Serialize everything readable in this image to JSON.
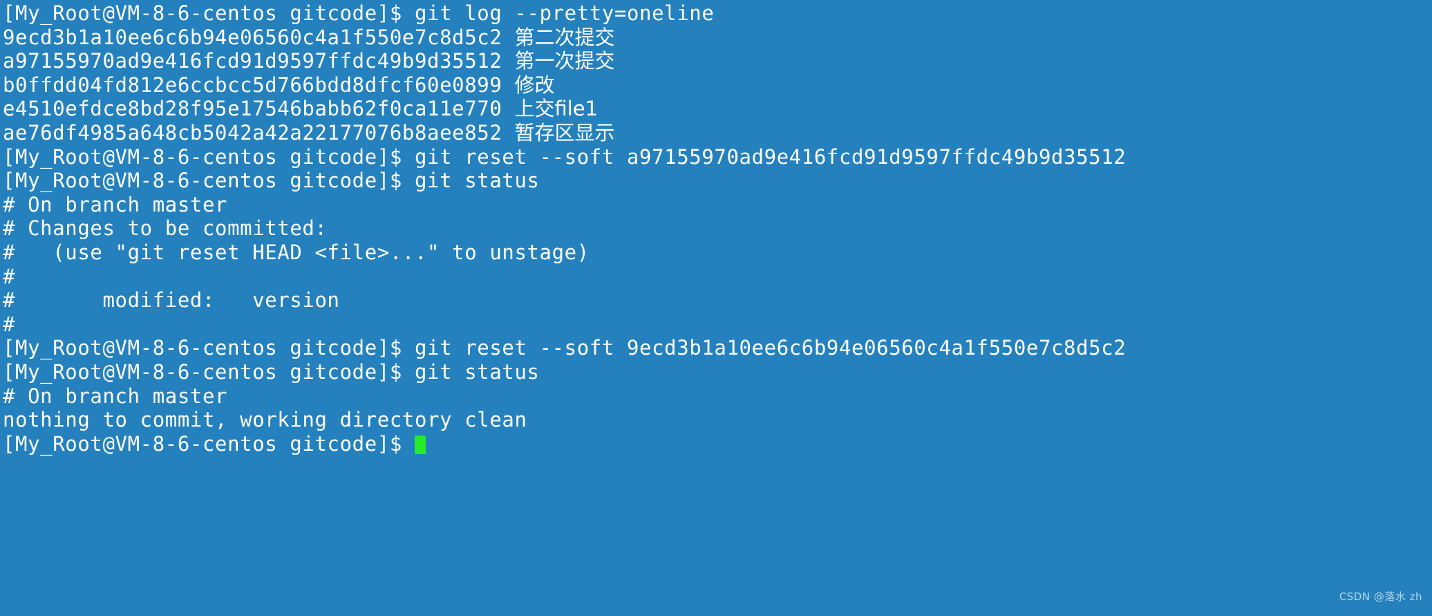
{
  "terminal": {
    "background_color": "#2581bd",
    "text_color": "#ffffff",
    "cursor_color": "#25ec25",
    "prompt": "[My_Root@VM-8-6-centos gitcode]$ ",
    "lines": [
      {
        "type": "command",
        "prompt": "[My_Root@VM-8-6-centos gitcode]$ ",
        "command": "git log --pretty=oneline"
      },
      {
        "type": "log",
        "hash": "9ecd3b1a10ee6c6b94e06560c4a1f550e7c8d5c2",
        "message": "第二次提交"
      },
      {
        "type": "log",
        "hash": "a97155970ad9e416fcd91d9597ffdc49b9d35512",
        "message": "第一次提交"
      },
      {
        "type": "log",
        "hash": "b0ffdd04fd812e6ccbcc5d766bdd8dfcf60e0899",
        "message": "修改"
      },
      {
        "type": "log",
        "hash": "e4510efdce8bd28f95e17546babb62f0ca11e770",
        "message": "上交file1"
      },
      {
        "type": "log",
        "hash": "ae76df4985a648cb5042a42a22177076b8aee852",
        "message": "暂存区显示"
      },
      {
        "type": "command",
        "prompt": "[My_Root@VM-8-6-centos gitcode]$ ",
        "command": "git reset --soft a97155970ad9e416fcd91d9597ffdc49b9d35512"
      },
      {
        "type": "command",
        "prompt": "[My_Root@VM-8-6-centos gitcode]$ ",
        "command": "git status"
      },
      {
        "type": "output",
        "text": "# On branch master"
      },
      {
        "type": "output",
        "text": "# Changes to be committed:"
      },
      {
        "type": "output",
        "text": "#   (use \"git reset HEAD <file>...\" to unstage)"
      },
      {
        "type": "output",
        "text": "#"
      },
      {
        "type": "output",
        "text": "#       modified:   version"
      },
      {
        "type": "output",
        "text": "#"
      },
      {
        "type": "command",
        "prompt": "[My_Root@VM-8-6-centos gitcode]$ ",
        "command": "git reset --soft 9ecd3b1a10ee6c6b94e06560c4a1f550e7c8d5c2"
      },
      {
        "type": "command",
        "prompt": "[My_Root@VM-8-6-centos gitcode]$ ",
        "command": "git status"
      },
      {
        "type": "output",
        "text": "# On branch master"
      },
      {
        "type": "output",
        "text": "nothing to commit, working directory clean"
      },
      {
        "type": "prompt-cursor",
        "prompt": "[My_Root@VM-8-6-centos gitcode]$ "
      }
    ]
  },
  "watermark": {
    "text": "CSDN @落水 zh"
  }
}
